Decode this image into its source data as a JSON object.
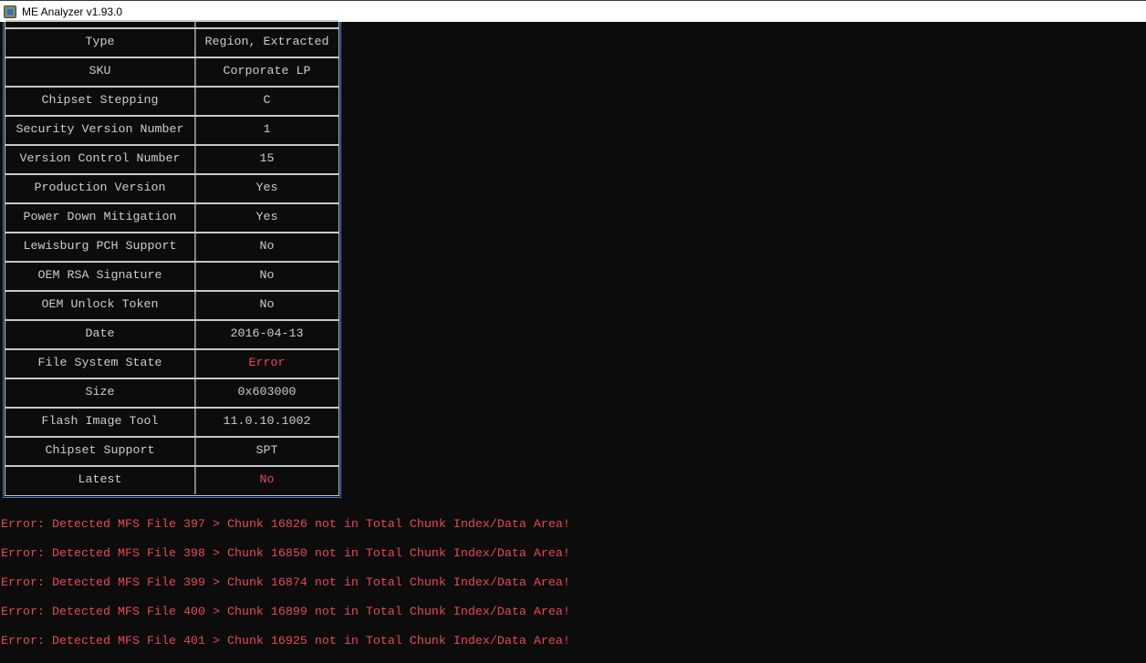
{
  "window": {
    "title": "ME Analyzer v1.93.0"
  },
  "table": {
    "rows": [
      {
        "label": "Type",
        "value": "Region, Extracted"
      },
      {
        "label": "SKU",
        "value": "Corporate LP"
      },
      {
        "label": "Chipset Stepping",
        "value": "C"
      },
      {
        "label": "Security Version Number",
        "value": "1"
      },
      {
        "label": "Version Control Number",
        "value": "15"
      },
      {
        "label": "Production Version",
        "value": "Yes"
      },
      {
        "label": "Power Down Mitigation",
        "value": "Yes"
      },
      {
        "label": "Lewisburg PCH Support",
        "value": "No"
      },
      {
        "label": "OEM RSA Signature",
        "value": "No"
      },
      {
        "label": "OEM Unlock Token",
        "value": "No"
      },
      {
        "label": "Date",
        "value": "2016-04-13"
      },
      {
        "label": "File System State",
        "value": "Error",
        "status": "error"
      },
      {
        "label": "Size",
        "value": "0x603000"
      },
      {
        "label": "Flash Image Tool",
        "value": "11.0.10.1002"
      },
      {
        "label": "Chipset Support",
        "value": "SPT"
      },
      {
        "label": "Latest",
        "value": "No",
        "status": "error"
      }
    ]
  },
  "errors": [
    "Error: Detected MFS File 397 > Chunk 16826 not in Total Chunk Index/Data Area!",
    "Error: Detected MFS File 398 > Chunk 16850 not in Total Chunk Index/Data Area!",
    "Error: Detected MFS File 399 > Chunk 16874 not in Total Chunk Index/Data Area!",
    "Error: Detected MFS File 400 > Chunk 16899 not in Total Chunk Index/Data Area!",
    "Error: Detected MFS File 401 > Chunk 16925 not in Total Chunk Index/Data Area!"
  ],
  "colors": {
    "background": "#0c0c0c",
    "text": "#cccccc",
    "error": "#e74856"
  }
}
